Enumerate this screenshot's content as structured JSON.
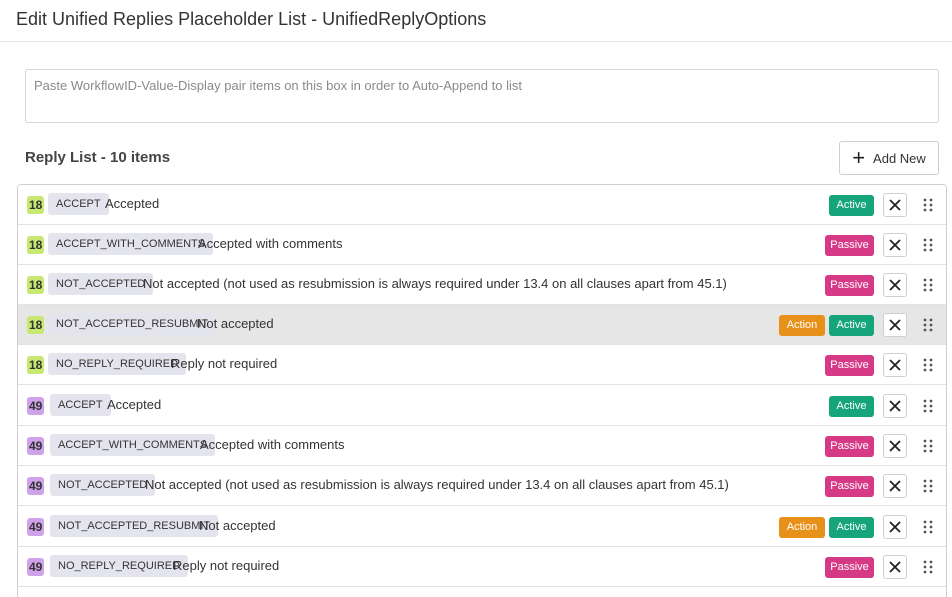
{
  "header": {
    "title": "Edit Unified Replies Placeholder List - UnifiedReplyOptions"
  },
  "paste_box": {
    "placeholder": "Paste WorkflowID-Value-Display pair items on this box in order to Auto-Append to list"
  },
  "list": {
    "title": "Reply List - 10 items",
    "add_new_label": "Add New",
    "badge_labels": {
      "action": "Action",
      "active": "Active",
      "passive": "Passive"
    },
    "rows": [
      {
        "workflow": "18",
        "code": "ACCEPT",
        "display": "Accepted",
        "status": "Active",
        "action": false,
        "highlighted": false
      },
      {
        "workflow": "18",
        "code": "ACCEPT_WITH_COMMENTS",
        "display": "Accepted with comments",
        "status": "Passive",
        "action": false,
        "highlighted": false
      },
      {
        "workflow": "18",
        "code": "NOT_ACCEPTED",
        "display": "Not accepted (not used as resubmission is always required under 13.4 on all clauses apart from 45.1)",
        "status": "Passive",
        "action": false,
        "highlighted": false
      },
      {
        "workflow": "18",
        "code": "NOT_ACCEPTED_RESUBMIT",
        "display": "Not accepted",
        "status": "Active",
        "action": true,
        "highlighted": true
      },
      {
        "workflow": "18",
        "code": "NO_REPLY_REQUIRED",
        "display": "Reply not required",
        "status": "Passive",
        "action": false,
        "highlighted": false
      },
      {
        "workflow": "49",
        "code": "ACCEPT",
        "display": "Accepted",
        "status": "Active",
        "action": false,
        "highlighted": false
      },
      {
        "workflow": "49",
        "code": "ACCEPT_WITH_COMMENTS",
        "display": "Accepted with comments",
        "status": "Passive",
        "action": false,
        "highlighted": false
      },
      {
        "workflow": "49",
        "code": "NOT_ACCEPTED",
        "display": "Not accepted (not used as resubmission is always required under 13.4 on all clauses apart from 45.1)",
        "status": "Passive",
        "action": false,
        "highlighted": false
      },
      {
        "workflow": "49",
        "code": "NOT_ACCEPTED_RESUBMIT",
        "display": "Not accepted",
        "status": "Active",
        "action": true,
        "highlighted": false
      },
      {
        "workflow": "49",
        "code": "NO_REPLY_REQUIRED",
        "display": "Reply not required",
        "status": "Passive",
        "action": false,
        "highlighted": false
      }
    ]
  },
  "icons": {
    "add": "plus-icon",
    "remove": "close-icon",
    "drag": "drag-handle-icon"
  },
  "colors": {
    "workflow_18": "#c8e86f",
    "workflow_49": "#cfa2ea",
    "active": "#16a57a",
    "passive": "#d63a86",
    "action": "#e8911a",
    "highlight_row": "#e6e6e6"
  }
}
